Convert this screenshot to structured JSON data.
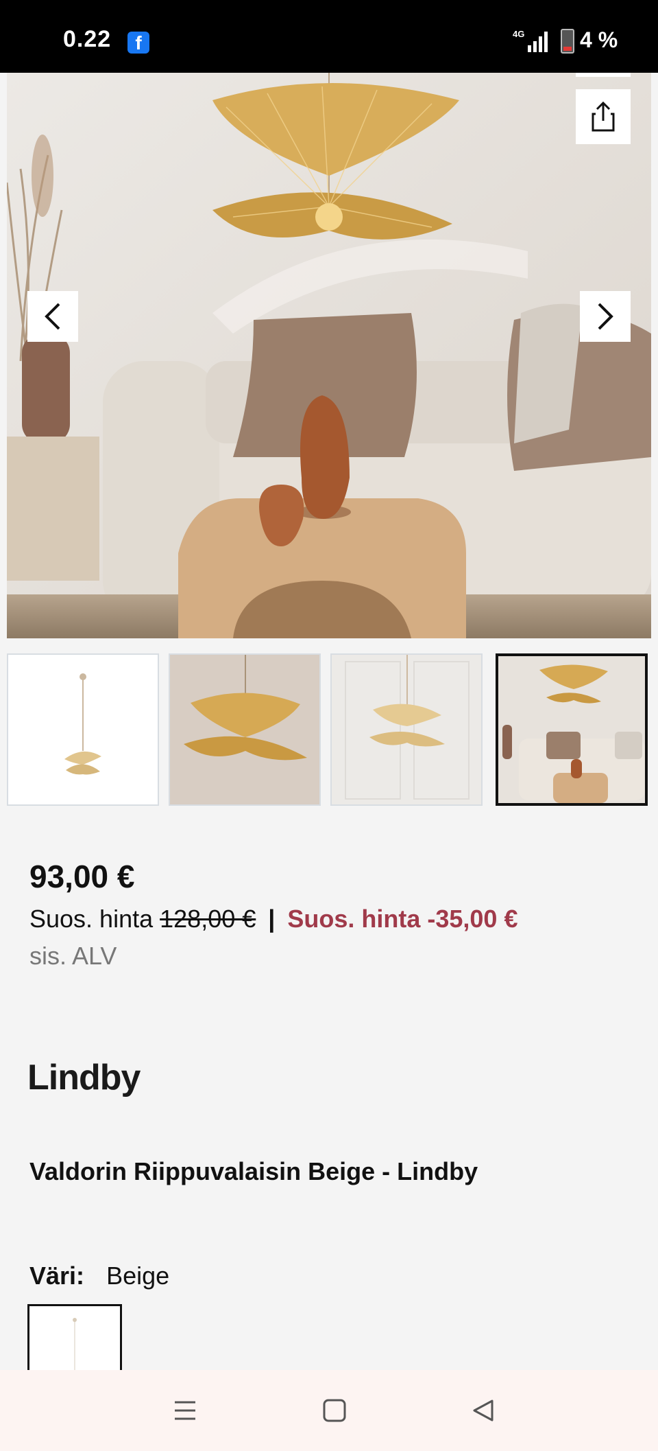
{
  "status_bar": {
    "time": "0.22",
    "app_icon": "facebook-icon",
    "network": "4G",
    "battery": "4 %"
  },
  "gallery": {
    "prev_icon": "chevron-left-icon",
    "next_icon": "chevron-right-icon",
    "share_icon": "share-icon",
    "thumbnail_count": 4,
    "active_thumbnail_index": 3
  },
  "product": {
    "price": "93,00 €",
    "recommended_label": "Suos. hinta",
    "recommended_price": "128,00 €",
    "separator": "|",
    "discount_text": "Suos. hinta -35,00 €",
    "vat_note": "sis. ALV",
    "brand": "Lindby",
    "title": "Valdorin Riippuvalaisin Beige - Lindby",
    "color_label": "Väri:",
    "color_value": "Beige"
  },
  "colors": {
    "discount": "#a03a4a",
    "background": "#f4f4f4"
  },
  "nav_bar": {
    "menu_icon": "recent-apps-icon",
    "home_icon": "home-icon",
    "back_icon": "back-icon"
  }
}
